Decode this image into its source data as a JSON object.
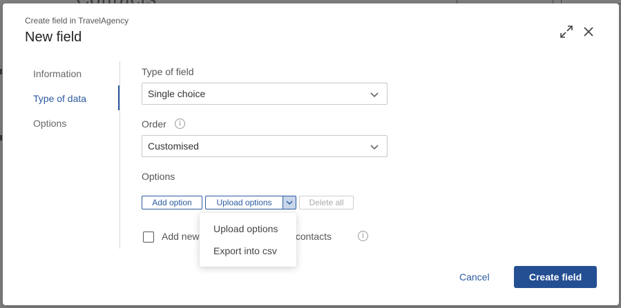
{
  "background": {
    "page_heading": "Contacts"
  },
  "modal": {
    "subtitle": "Create field in TravelAgency",
    "title": "New field"
  },
  "nav": {
    "items": [
      {
        "label": "Information",
        "active": false
      },
      {
        "label": "Type of data",
        "active": true
      },
      {
        "label": "Options",
        "active": false
      }
    ]
  },
  "form": {
    "type_of_field": {
      "label": "Type of field",
      "value": "Single choice"
    },
    "order": {
      "label": "Order",
      "value": "Customised"
    },
    "options": {
      "label": "Options",
      "add_option": "Add option",
      "upload_options": "Upload options",
      "delete_all": "Delete all"
    },
    "checkbox": {
      "label_start": "Add new",
      "label_end": "ng contacts",
      "checked": false
    }
  },
  "dropdown": {
    "items": [
      "Upload options",
      "Export into csv"
    ]
  },
  "footer": {
    "cancel": "Cancel",
    "create": "Create field"
  },
  "colors": {
    "accent": "#2a5aa0",
    "primary_button": "#254f93",
    "overlay": "#7f7f7f"
  }
}
